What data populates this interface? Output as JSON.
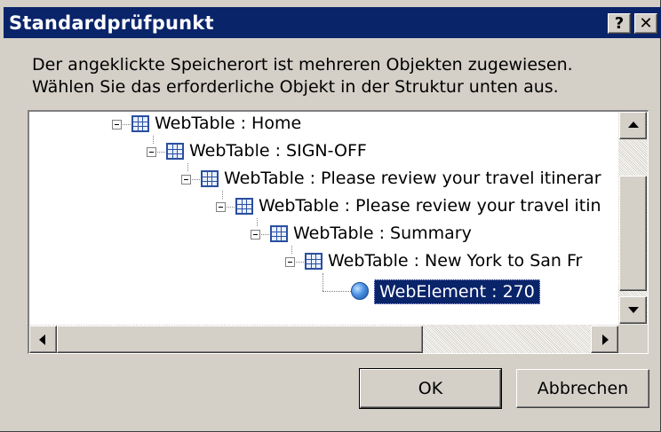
{
  "dialog": {
    "title": "Standardprüfpunkt",
    "help_button": "?",
    "close_button": "✕",
    "message_line1": "Der angeklickte Speicherort ist mehreren Objekten zugewiesen.",
    "message_line2": "Wählen Sie das erforderliche Objekt in der Struktur unten aus."
  },
  "tree": {
    "nodes": [
      {
        "label": "WebTable : Home",
        "icon": "table-icon",
        "expanded": true
      },
      {
        "label": "WebTable : SIGN-OFF",
        "icon": "table-icon",
        "expanded": true
      },
      {
        "label": "WebTable : Please review your travel itinerar",
        "icon": "table-icon",
        "expanded": true
      },
      {
        "label": "WebTable : Please review your travel itin",
        "icon": "table-icon",
        "expanded": true
      },
      {
        "label": "WebTable : Summary",
        "icon": "table-icon",
        "expanded": true
      },
      {
        "label": "WebTable : New York to San Fr",
        "icon": "table-icon",
        "expanded": true
      }
    ],
    "selected": {
      "label": "WebElement : 270",
      "icon": "globe-icon"
    }
  },
  "buttons": {
    "ok": "OK",
    "cancel": "Abbrechen"
  },
  "colors": {
    "titlebar": "#0a246a",
    "selection": "#0a246a",
    "face": "#d4d0c8"
  }
}
